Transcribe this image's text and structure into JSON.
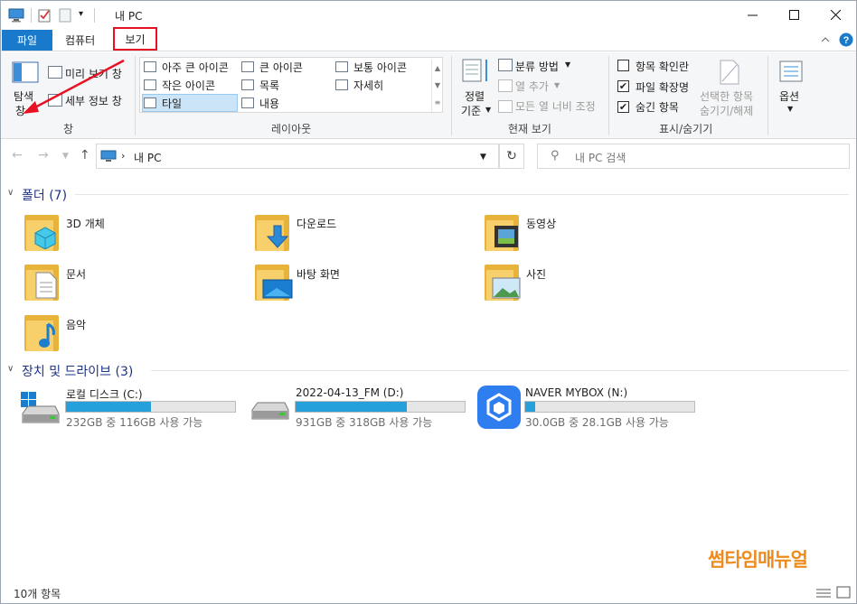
{
  "window": {
    "title": "내 PC"
  },
  "tabs": {
    "file": "파일",
    "computer": "컴퓨터",
    "view": "보기"
  },
  "ribbon": {
    "pane": {
      "nav_pane_line1": "탐색",
      "nav_pane_line2": "창",
      "preview": "미리 보기 창",
      "details": "세부 정보 창",
      "group": "창"
    },
    "layout": {
      "items": [
        "아주 큰 아이콘",
        "큰 아이콘",
        "보통 아이콘",
        "작은 아이콘",
        "목록",
        "자세히",
        "타일",
        "내용"
      ],
      "group": "레이아웃"
    },
    "current_view": {
      "sort_line1": "정렬",
      "sort_line2": "기준",
      "group_by": "분류 방법",
      "add_column": "열 추가",
      "fit_columns": "모든 열 너비 조정",
      "group": "현재 보기"
    },
    "show_hide": {
      "item_checkboxes": "항목 확인란",
      "file_extensions": "파일 확장명",
      "hidden_items": "숨긴 항목",
      "hide_selected_line1": "선택한 항목",
      "hide_selected_line2": "숨기기/해제",
      "group": "표시/숨기기",
      "checks": [
        false,
        true,
        true
      ]
    },
    "options": {
      "label": "옵션"
    }
  },
  "address": {
    "path": "내 PC",
    "search_placeholder": "내 PC 검색"
  },
  "folders": {
    "header": "폴더 (7)",
    "items": [
      "3D 개체",
      "다운로드",
      "동영상",
      "문서",
      "바탕 화면",
      "사진",
      "음악"
    ]
  },
  "drives": {
    "header": "장치 및 드라이브 (3)",
    "items": [
      {
        "name": "로컬 디스크 (C:)",
        "info": "232GB 중 116GB 사용 가능",
        "used_fraction": 0.5
      },
      {
        "name": "2022-04-13_FM (D:)",
        "info": "931GB 중 318GB 사용 가능",
        "used_fraction": 0.66
      },
      {
        "name": "NAVER MYBOX (N:)",
        "info": "30.0GB 중 28.1GB 사용 가능",
        "used_fraction": 0.06
      }
    ]
  },
  "status": {
    "item_count": "10개 항목"
  },
  "watermark": "썸타임매뉴얼",
  "colors": {
    "accent": "#1979ca",
    "highlight_box": "#e81123",
    "bar_fill": "#26a0da",
    "watermark": "#ef8a1c"
  }
}
